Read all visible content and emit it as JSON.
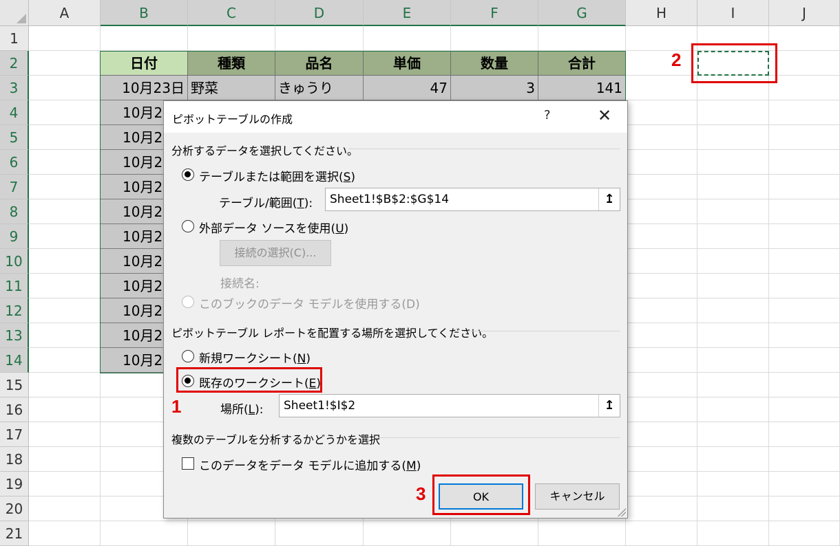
{
  "sheet": {
    "columns": [
      "A",
      "B",
      "C",
      "D",
      "E",
      "F",
      "G",
      "H",
      "I",
      "J"
    ],
    "rows": [
      "1",
      "2",
      "3",
      "4",
      "5",
      "6",
      "7",
      "8",
      "9",
      "10",
      "11",
      "12",
      "13",
      "14",
      "15",
      "16",
      "17",
      "18",
      "19",
      "20",
      "21"
    ],
    "table_headers": [
      "日付",
      "種類",
      "品名",
      "単価",
      "数量",
      "合計"
    ],
    "first_row": [
      "10月23日",
      "野菜",
      "きゅうり",
      "47",
      "3",
      "141"
    ],
    "partial_dates": [
      "10月2",
      "10月2",
      "10月2",
      "10月2",
      "10月2",
      "10月2",
      "10月2",
      "10月2",
      "10月2",
      "10月2",
      "10月2"
    ]
  },
  "dialog": {
    "title": "ピボットテーブルの作成",
    "help": "?",
    "close": "✕",
    "section1": "分析するデータを選択してください。",
    "opt_table_range": "テーブルまたは範囲を選択(",
    "opt_table_range_key": "S",
    "table_range_label": "テーブル/範囲(",
    "table_range_key": "T",
    "table_range_value": "Sheet1!$B$2:$G$14",
    "opt_external": "外部データ ソースを使用(",
    "opt_external_key": "U",
    "connect_button": "接続の選択(C)...",
    "connect_name": "接続名:",
    "opt_data_model": "このブックのデータ モデルを使用する(D)",
    "section2": "ピボットテーブル レポートを配置する場所を選択してください。",
    "opt_new_sheet": "新規ワークシート(",
    "opt_new_sheet_key": "N",
    "opt_existing_sheet": "既存のワークシート(",
    "opt_existing_sheet_key": "E",
    "location_label": "場所(",
    "location_key": "L",
    "location_value": "Sheet1!$I$2",
    "section3": "複数のテーブルを分析するかどうかを選択",
    "add_data_model": "このデータをデータ モデルに追加する(",
    "add_data_model_key": "M",
    "ok": "OK",
    "cancel": "キャンセル",
    "range_button_icon": "↥"
  },
  "annotations": {
    "step1": "1",
    "step2": "2",
    "step3": "3"
  },
  "colors": {
    "excel_green": "#217346",
    "annotation_red": "#e00000",
    "header_fill": "#9caf88",
    "date_header_fill": "#c6e0b4"
  }
}
